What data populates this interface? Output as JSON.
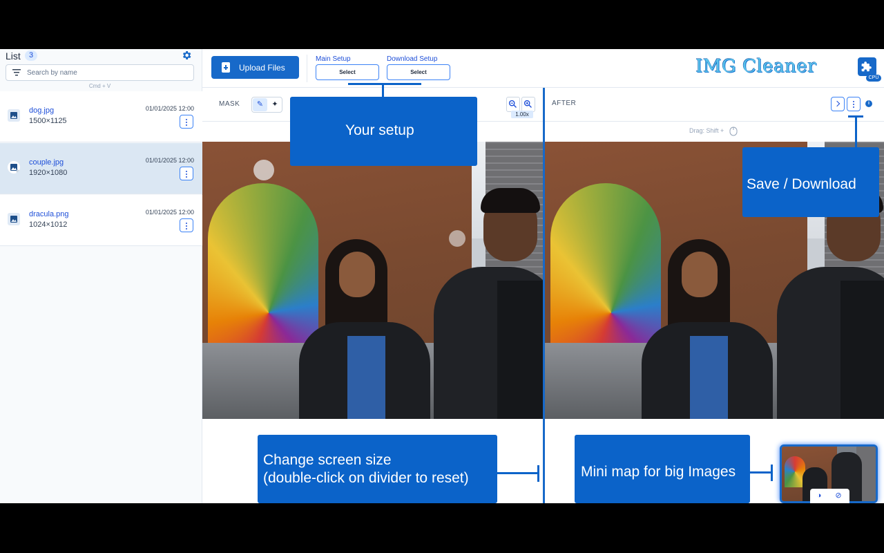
{
  "sidebar": {
    "title": "List",
    "count": "3",
    "search_placeholder": "Search by name",
    "paste_hint": "Cmd + V",
    "files": [
      {
        "name": "dog.jpg",
        "dims": "1500×1125",
        "date": "01/01/2025 12:00"
      },
      {
        "name": "couple.jpg",
        "dims": "1920×1080",
        "date": "01/01/2025 12:00"
      },
      {
        "name": "dracula.png",
        "dims": "1024×1012",
        "date": "01/01/2025 12:00"
      }
    ]
  },
  "topbar": {
    "upload_label": "Upload Files",
    "main_setup_label": "Main Setup",
    "main_setup_value": "Select",
    "download_setup_label": "Download Setup",
    "download_setup_value": "Select",
    "logo": "IMG Cleaner",
    "cpu_badge": "CPU"
  },
  "left_panel": {
    "label": "MASK",
    "zoom": "1.00x"
  },
  "right_panel": {
    "label": "AFTER",
    "drag_hint": "Drag: Shift +"
  },
  "annotations": {
    "your_setup": "Your setup",
    "save_download": "Save / Download",
    "change_size_line1": "Change screen size",
    "change_size_line2": "(double-click on divider to reset)",
    "mini_map": "Mini map for big Images"
  },
  "colors": {
    "accent": "#1769c9",
    "annotation": "#0b63c9",
    "selected_row": "#dbe7f3"
  },
  "icons": [
    "gear-icon",
    "filter-icon",
    "image-icon",
    "more-vert-icon",
    "upload-file-icon",
    "extension-icon",
    "brush-icon",
    "magic-wand-icon",
    "zoom-out-icon",
    "zoom-in-icon",
    "chevron-right-icon",
    "info-icon",
    "mouse-icon",
    "contrast-icon",
    "hide-icon"
  ]
}
